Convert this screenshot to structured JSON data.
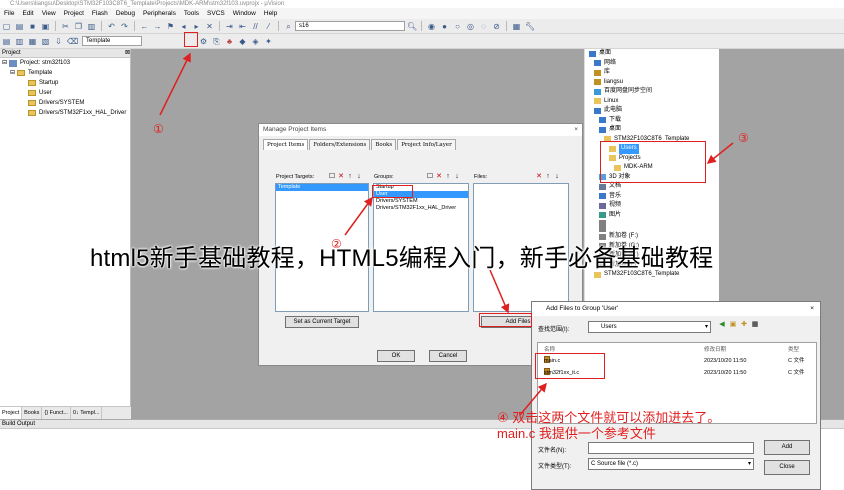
{
  "window": {
    "title": "C:\\Users\\liangsu\\Desktop\\STM32F103C8T6_Template\\Projects\\MDK-ARM\\stm32f103.uvprojx - µVision"
  },
  "menu": [
    "File",
    "Edit",
    "View",
    "Project",
    "Flash",
    "Debug",
    "Peripherals",
    "Tools",
    "SVCS",
    "Window",
    "Help"
  ],
  "toolbar": {
    "search_value": "s16",
    "target_value": "Template"
  },
  "project_panel": {
    "header": "Project",
    "root": "Project: stm32f103",
    "target": "Template",
    "groups": [
      "Startup",
      "User",
      "Drivers/SYSTEM",
      "Drivers/STM32F1xx_HAL_Driver"
    ],
    "tabs": [
      "Project",
      "Books",
      "{} Funct...",
      "0↓ Templ..."
    ]
  },
  "build_output": {
    "header": "Build Output"
  },
  "manage_dialog": {
    "title": "Manage Project Items",
    "close": "×",
    "tabs": [
      "Project Items",
      "Folders/Extensions",
      "Books",
      "Project Info/Layer"
    ],
    "targets_label": "Project Targets:",
    "groups_label": "Groups:",
    "files_label": "Files:",
    "targets": [
      "Template"
    ],
    "groups": [
      "Startup",
      "User",
      "Drivers/SYSTEM",
      "Drivers/STM32F1xx_HAL_Driver"
    ],
    "selected_group": "User",
    "set_current_button": "Set as Current Target",
    "add_files_button": "Add Files",
    "ok_button": "OK",
    "cancel_button": "Cancel"
  },
  "folder_tree": {
    "items": [
      {
        "label": "桌面",
        "indent": 0,
        "icon": "desktop"
      },
      {
        "label": "网络",
        "indent": 1,
        "icon": "network"
      },
      {
        "label": "库",
        "indent": 1,
        "icon": "library"
      },
      {
        "label": "liangsu",
        "indent": 1,
        "icon": "user"
      },
      {
        "label": "百度网盘同步空间",
        "indent": 1,
        "icon": "cloud"
      },
      {
        "label": "Linux",
        "indent": 1,
        "icon": "folder"
      },
      {
        "label": "此电脑",
        "indent": 1,
        "icon": "computer"
      },
      {
        "label": "下载",
        "indent": 2,
        "icon": "download"
      },
      {
        "label": "桌面",
        "indent": 2,
        "icon": "desktop"
      },
      {
        "label": "STM32F103C8T6_Template",
        "indent": 3,
        "icon": "folder"
      },
      {
        "label": "Users",
        "indent": 4,
        "icon": "folder",
        "selected": true
      },
      {
        "label": "Projects",
        "indent": 4,
        "icon": "folder"
      },
      {
        "label": "MDK-ARM",
        "indent": 5,
        "icon": "folder"
      },
      {
        "label": "3D 对象",
        "indent": 2,
        "icon": "3d"
      },
      {
        "label": "文档",
        "indent": 2,
        "icon": "doc"
      },
      {
        "label": "音乐",
        "indent": 2,
        "icon": "music"
      },
      {
        "label": "视频",
        "indent": 2,
        "icon": "video"
      },
      {
        "label": "图片",
        "indent": 2,
        "icon": "pic"
      },
      {
        "label": "",
        "indent": 2,
        "icon": "drive"
      },
      {
        "label": "",
        "indent": 2,
        "icon": "drive"
      },
      {
        "label": "新加卷 (F:)",
        "indent": 2,
        "icon": "drive"
      },
      {
        "label": "新加卷 (G:)",
        "indent": 2,
        "icon": "drive"
      },
      {
        "label": "新加卷 (H:)",
        "indent": 2,
        "icon": "drive"
      },
      {
        "label": "新加卷 (I:)",
        "indent": 2,
        "icon": "drive"
      },
      {
        "label": "STM32F103C8T6_Template",
        "indent": 1,
        "icon": "folder"
      }
    ]
  },
  "add_dialog": {
    "title": "Add Files to Group 'User'",
    "close": "×",
    "look_in_label": "查找范围(I):",
    "look_in_value": "Users",
    "col_name": "名称",
    "col_date": "修改日期",
    "col_type": "类型",
    "files": [
      {
        "name": "main.c",
        "date": "2023/10/20 11:50",
        "type": "C 文件"
      },
      {
        "name": "stm32f1xx_it.c",
        "date": "2023/10/20 11:50",
        "type": "C 文件"
      }
    ],
    "filename_label": "文件名(N):",
    "filename_value": "",
    "filetype_label": "文件类型(T):",
    "filetype_value": "C Source file (*.c)",
    "add_button": "Add",
    "close_button": "Close"
  },
  "annotations": {
    "step1": "①",
    "step2": "②",
    "step3": "③",
    "step4_line1": "④ 双击这两个文件就可以添加进去了。",
    "step4_line2": "main.c  我提供一个参考文件"
  },
  "watermark": "html5新手基础教程，HTML5编程入门，新手必备基础教程",
  "colors": {
    "annotation": "#e02020",
    "selection": "#3399ff",
    "editor_bg": "#a3a3a3"
  }
}
